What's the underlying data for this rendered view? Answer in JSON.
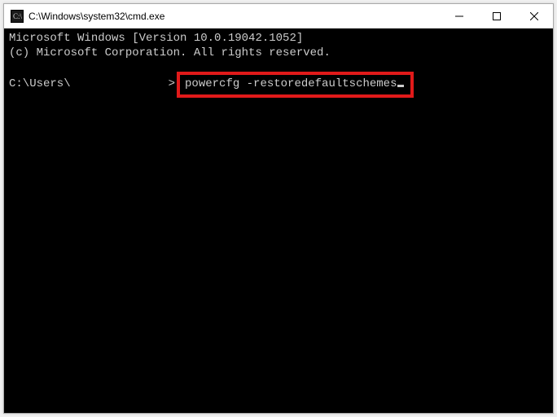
{
  "titlebar": {
    "title": "C:\\Windows\\system32\\cmd.exe"
  },
  "terminal": {
    "line1": "Microsoft Windows [Version 10.0.19042.1052]",
    "line2": "(c) Microsoft Corporation. All rights reserved.",
    "prompt_prefix": "C:\\Users\\",
    "prompt_gt": ">",
    "command": "powercfg -restoredefaultschemes"
  },
  "highlight_color": "#e11a1a"
}
